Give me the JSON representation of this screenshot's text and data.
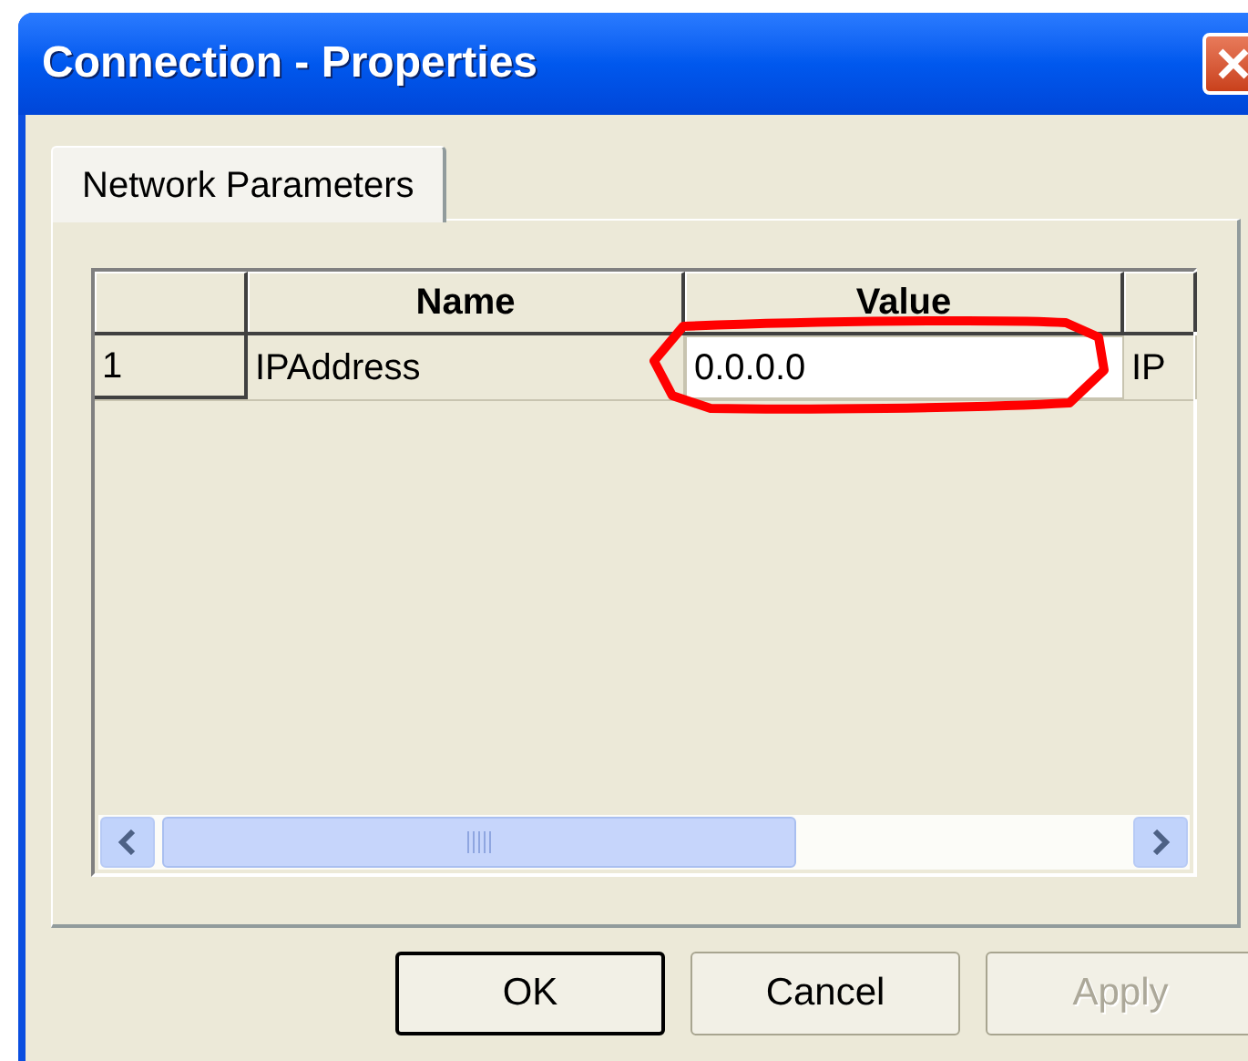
{
  "window": {
    "title": "Connection - Properties"
  },
  "tabs": [
    {
      "label": "Network Parameters",
      "selected": true
    }
  ],
  "table": {
    "columns": [
      "",
      "Name",
      "Value",
      ""
    ],
    "rows": [
      {
        "cells": [
          "1",
          "IPAddress",
          "0.0.0.0",
          "IP"
        ],
        "editing": true
      }
    ]
  },
  "buttons": [
    {
      "label": "OK",
      "default": true,
      "disabled": false
    },
    {
      "label": "Cancel",
      "default": false,
      "disabled": false
    },
    {
      "label": "Apply",
      "default": false,
      "disabled": true
    }
  ]
}
